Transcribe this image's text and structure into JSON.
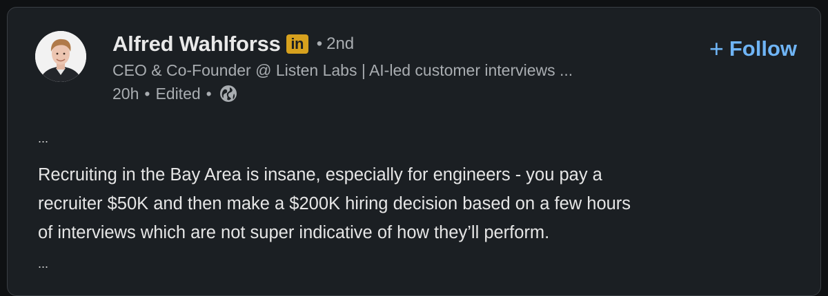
{
  "post": {
    "author_name": "Alfred Wahlforss",
    "badge_text": "in",
    "degree_sep": "•",
    "degree": "2nd",
    "headline": "CEO & Co-Founder @ Listen Labs | AI-led customer interviews ...",
    "time": "20h",
    "meta_sep": "•",
    "edited": "Edited",
    "follow_plus": "+",
    "follow_label": "Follow",
    "ellipsis_top": "...",
    "body_line_1": "Recruiting in the Bay Area is insane, especially for engineers - you pay a",
    "body_line_2": "recruiter $50K and then make a $200K hiring decision based on a few hours",
    "body_line_3": "of interviews which are not super indicative of how they’ll perform.",
    "ellipsis_bottom": "..."
  },
  "icons": {
    "linkedin_badge": "linkedin-in-icon",
    "visibility": "globe-icon",
    "avatar": "profile-photo"
  },
  "colors": {
    "card_bg": "#1b1f23",
    "follow_accent": "#6fb4f5",
    "badge_gold": "#d7a11e"
  }
}
